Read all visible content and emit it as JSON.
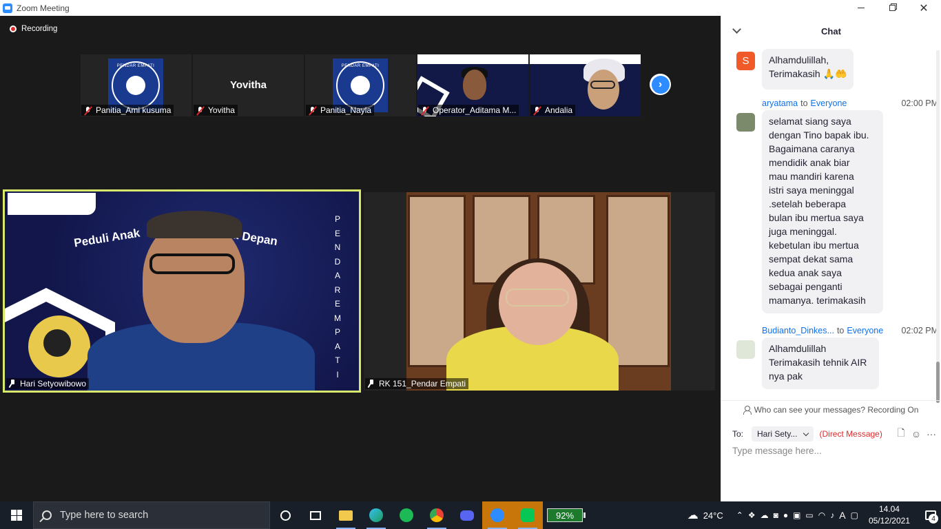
{
  "window": {
    "title": "Zoom Meeting"
  },
  "recording": {
    "label": "Recording"
  },
  "thumbnails": [
    {
      "name": "Panitia_Ami kusuma",
      "kind": "logo",
      "muted": true
    },
    {
      "name": "Yovitha",
      "kind": "name-only",
      "display": "Yovitha",
      "muted": true
    },
    {
      "name": "Panitia_Nayla",
      "kind": "logo",
      "muted": true
    },
    {
      "name": "Operator_Aditama M...",
      "kind": "video",
      "muted": true
    },
    {
      "name": "Andalia",
      "kind": "video",
      "muted": true
    }
  ],
  "logo_text": "PENDAR EMPATI",
  "speaker": {
    "name": "Hari Setyowibowo",
    "banner_left": "Peduli Anak",
    "banner_right": "a Depan",
    "vertical": "PENDAREMPATI"
  },
  "second_video": {
    "name": "RK 151_Pendar Empati"
  },
  "chat": {
    "title": "Chat",
    "messages": [
      {
        "avatar_letter": "S",
        "avatar_color": "#f05a28",
        "text_lines": [
          "Alhamdulillah,",
          "Terimakasih 🙏🤲"
        ]
      },
      {
        "from": "aryatama",
        "to_word": "to",
        "to": "Everyone",
        "time": "02:00 PM",
        "text_lines": [
          "selamat siang saya",
          "dengan Tino bapak ibu.",
          "Bagaimana caranya",
          "mendidik anak biar",
          "mau mandiri karena",
          "istri saya meninggal",
          ".setelah beberapa",
          "bulan ibu mertua saya",
          "juga meninggal.",
          "kebetulan ibu mertua",
          "sempat dekat sama",
          "kedua anak saya",
          "sebagai penganti",
          "mamanya. terimakasih"
        ]
      },
      {
        "from": "Budianto_Dinkes...",
        "to_word": "to",
        "to": "Everyone",
        "time": "02:02 PM",
        "text_lines": [
          "Alhamdulillah",
          "Terimakasih tehnik AIR",
          "nya pak"
        ]
      }
    ],
    "visibility_note": "Who can see your messages? Recording On",
    "to_label": "To:",
    "recipient": "Hari Sety...",
    "direct_message": "(Direct Message)",
    "placeholder": "Type message here..."
  },
  "taskbar": {
    "search_placeholder": "Type here to search",
    "battery": "92%",
    "weather": "24°C",
    "time": "14.04",
    "date": "05/12/2021",
    "notifications": "4"
  },
  "colors": {
    "accent": "#2d8cff",
    "speaker_border": "#d8e86a",
    "mute_red": "#e02828",
    "link_blue": "#0e71eb"
  }
}
